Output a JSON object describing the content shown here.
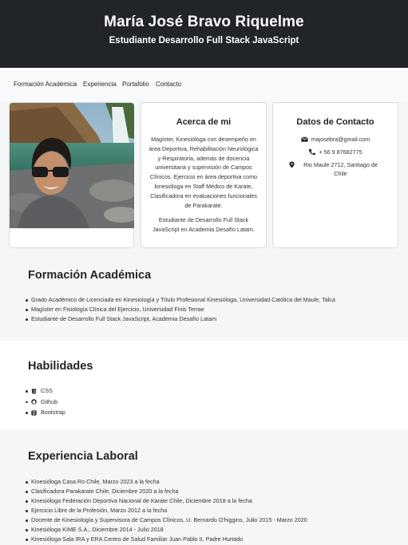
{
  "header": {
    "name": "María José Bravo Riquelme",
    "subtitle": "Estudiante Desarrollo Full Stack JavaScript"
  },
  "nav": {
    "items": [
      {
        "label": "Formación Académica"
      },
      {
        "label": "Experiencia"
      },
      {
        "label": "Portafolio"
      },
      {
        "label": "Contacto"
      }
    ]
  },
  "about": {
    "title": "Acerca de mi",
    "paragraph1": "Magíster, Kinesióloga con desempeño en área Deportiva, Rehabilitación Neurológica y Respiratoria, además de docencia universitaria y supervisión de Campos Clínicos. Ejercicio en área deportiva como kinesióloga en Staff Médico de Karate, Clasificadora en evaluaciones funcionales de Parakarate.",
    "paragraph2": "Estudiante de Desarrollo Full Stack JavaScript en Academia Desafío Latam."
  },
  "contact": {
    "title": "Datos de Contacto",
    "email": "majosebra@gmail.com",
    "phone": "+ 56 9 87682775",
    "address": "Rio Maule 2712, Santiago de Chile",
    "icons": [
      "envelope-icon",
      "phone-icon",
      "map-marker-icon"
    ]
  },
  "education": {
    "title": "Formación Académica",
    "items": [
      "Grado Académico de Licenciada en Kinesiología y Título Profesional Kinesióloga, Universidad Católica del Maule, Talca",
      "Magíster en Fisiología Clínica del Ejercicio, Universidad Finis Terrae",
      "Estudiante de Desarrollo Full Stack JavaScript, Academia Desafío Latam"
    ]
  },
  "skills": {
    "title": "Habilidades",
    "items": [
      {
        "label": "CSS",
        "icon": "css3-icon"
      },
      {
        "label": "Github",
        "icon": "github-icon"
      },
      {
        "label": "Bootstrap",
        "icon": "bootstrap-icon"
      }
    ]
  },
  "experience": {
    "title": "Experiencia Laboral",
    "items": [
      "Kinesióloga Casa Ro Chile, Marzo 2023 a la fecha",
      "Clasificadora Parakarate Chile, Diciembre 2020 a la fecha",
      "Kinesióloga Federación Deportiva Nacional de Karate Chile, Diciembre 2018 a la fecha",
      "Ejercicio Libre de la Profesión, Marzo 2012 a la fecha",
      "Docente de Kinesiología y Supervisora de Campos Clínicos, U. Bernardo O'higgins, Julio 2015 - Marzo 2020",
      "Kinesióloga KIME S.A., Diciembre 2014 - Julio 2018",
      "Kinesióloga Sala IRA y ERA Centro de Salud Familiar Juan Pablo II, Padre Hurtado"
    ]
  },
  "colors": {
    "header_bg": "#212529",
    "page_bg": "#f5f6f8",
    "card_bg": "#ffffff"
  }
}
